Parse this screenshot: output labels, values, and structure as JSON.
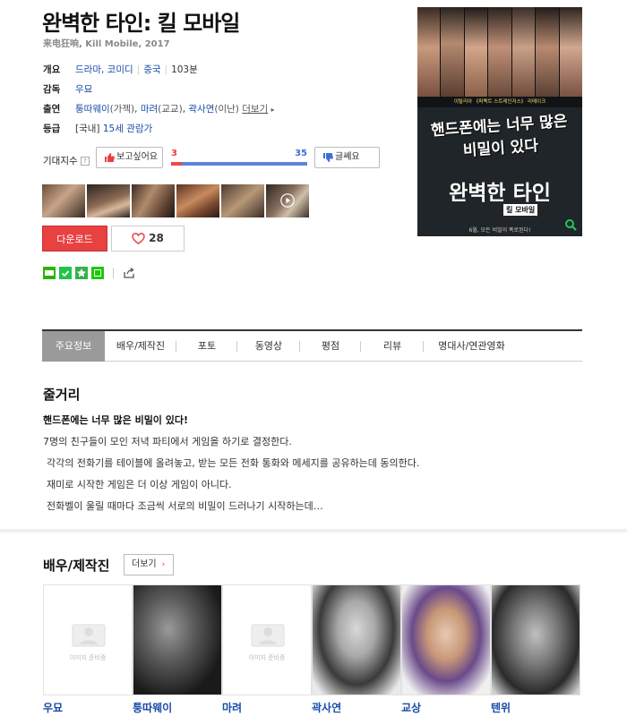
{
  "movie": {
    "title": "완벽한 타인: 킬 모바일",
    "subtitle": "来电狂响, Kill Mobile, 2017"
  },
  "info": {
    "overview_label": "개요",
    "genres": "드라마, 코미디",
    "country": "중국",
    "runtime": "103분",
    "director_label": "감독",
    "director": "우묘",
    "cast_label": "출연",
    "cast1_name": "퉁따웨이",
    "cast1_role": "(가젝)",
    "cast2_name": "마려",
    "cast2_role": "(교교)",
    "cast3_name": "곽사연",
    "cast3_role": "(이난)",
    "cast_more": "더보기",
    "rating_label": "등급",
    "rating_country": "[국내]",
    "rating_value": "15세 관람가"
  },
  "expectation": {
    "label": "기대지수",
    "help_icon": "?",
    "want_label": "보고싶어요",
    "want_count": "3",
    "meh_count": "35",
    "meh_label": "글쎄요",
    "want_fraction": 0.08
  },
  "actions": {
    "download_label": "다운로드",
    "like_count": "28"
  },
  "poster": {
    "band_text": "이탈리아 《퍼펙트 스트레인저스》 리메이크",
    "tagline": "핸드폰에는 너무 많은 비밀이 있다",
    "main_title": "완벽한 타인",
    "sub_title": "킬 모바일",
    "footer": "6월, 모든 비밀이 폭로된다!"
  },
  "tabs": [
    {
      "label": "주요정보"
    },
    {
      "label": "배우/제작진"
    },
    {
      "label": "포토"
    },
    {
      "label": "동영상"
    },
    {
      "label": "평점"
    },
    {
      "label": "리뷰"
    },
    {
      "label": "명대사/연관영화"
    }
  ],
  "synopsis": {
    "heading": "줄거리",
    "headline": "핸드폰에는 너무 많은 비밀이 있다!",
    "line1": "7명의 친구들이 모인 저녁 파티에서 게임을 하기로 결정한다.",
    "line2": "각각의 전화기를 테이블에 올려놓고, 받는 모든 전화 통화와 메세지를 공유하는데 동의한다.",
    "line3": "재미로 시작한 게임은 더 이상 게임이 아니다.",
    "line4": "전화벨이 울릴 때마다 조금씩 서로의 비밀이 드러나기 시작하는데…"
  },
  "cast_section": {
    "heading": "배우/제작진",
    "more_label": "더보기",
    "placeholder_text": "이미지 준비중",
    "people": [
      {
        "name": "우묘"
      },
      {
        "name": "퉁따웨이"
      },
      {
        "name": "마려"
      },
      {
        "name": "곽사연"
      },
      {
        "name": "교상"
      },
      {
        "name": "텐위"
      }
    ]
  },
  "colors": {
    "accent_red": "#e84141",
    "link_blue": "#1a4ba8",
    "bar_blue": "#5b86de"
  }
}
